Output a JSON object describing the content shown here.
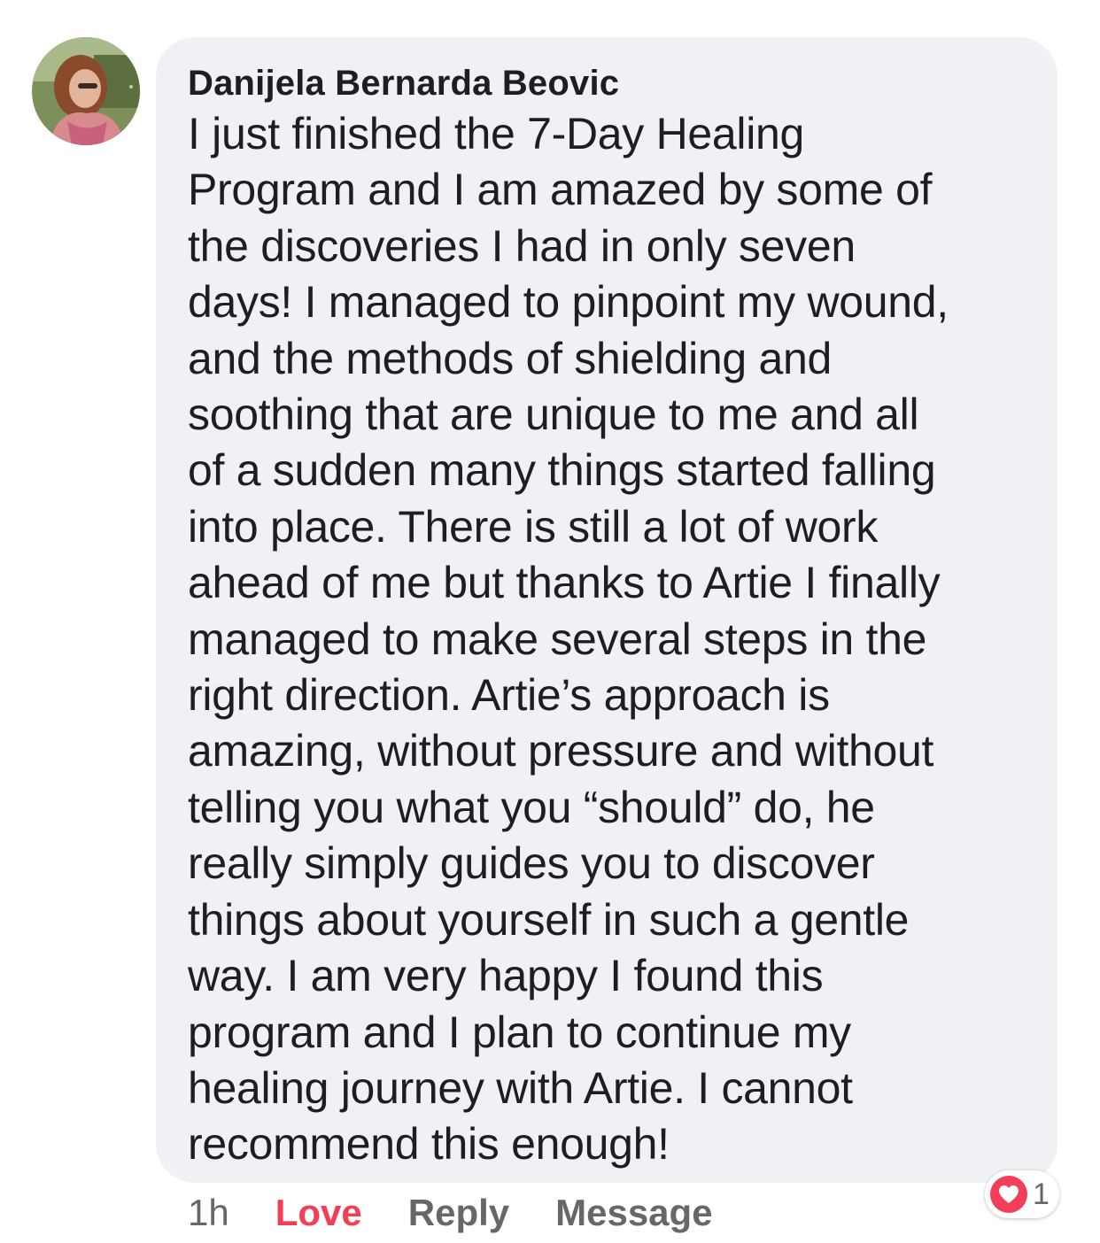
{
  "comment": {
    "author": "Danijela Bernarda Beovic",
    "avatar_icon": "profile-photo",
    "lines": [
      "I just finished the 7-Day Healing",
      "Program and I am amazed by some of",
      "the discoveries I had in only seven",
      "days! I managed to pinpoint my wound,",
      "and the methods of shielding and",
      "soothing that are unique to me and all",
      "of a sudden many things started falling",
      "into place. There is still a lot of work",
      "ahead of me but thanks to Artie I finally",
      "managed to make several steps in the",
      "right direction. Artie’s approach is",
      "amazing, without pressure and without",
      "telling you what you “should” do, he",
      "really simply guides you to discover",
      "things about yourself in such a gentle",
      "way. I am very happy I found this",
      "program and I plan to continue my",
      "healing journey with Artie. I cannot",
      "recommend this enough!"
    ]
  },
  "actions": {
    "time": "1h",
    "love": "Love",
    "reply": "Reply",
    "message": "Message"
  },
  "reaction": {
    "icon": "heart-icon",
    "count": "1"
  },
  "colors": {
    "bubble": "#f0f1f4",
    "love": "#f33e58",
    "muted": "#65676b",
    "text": "#1c1e21"
  }
}
